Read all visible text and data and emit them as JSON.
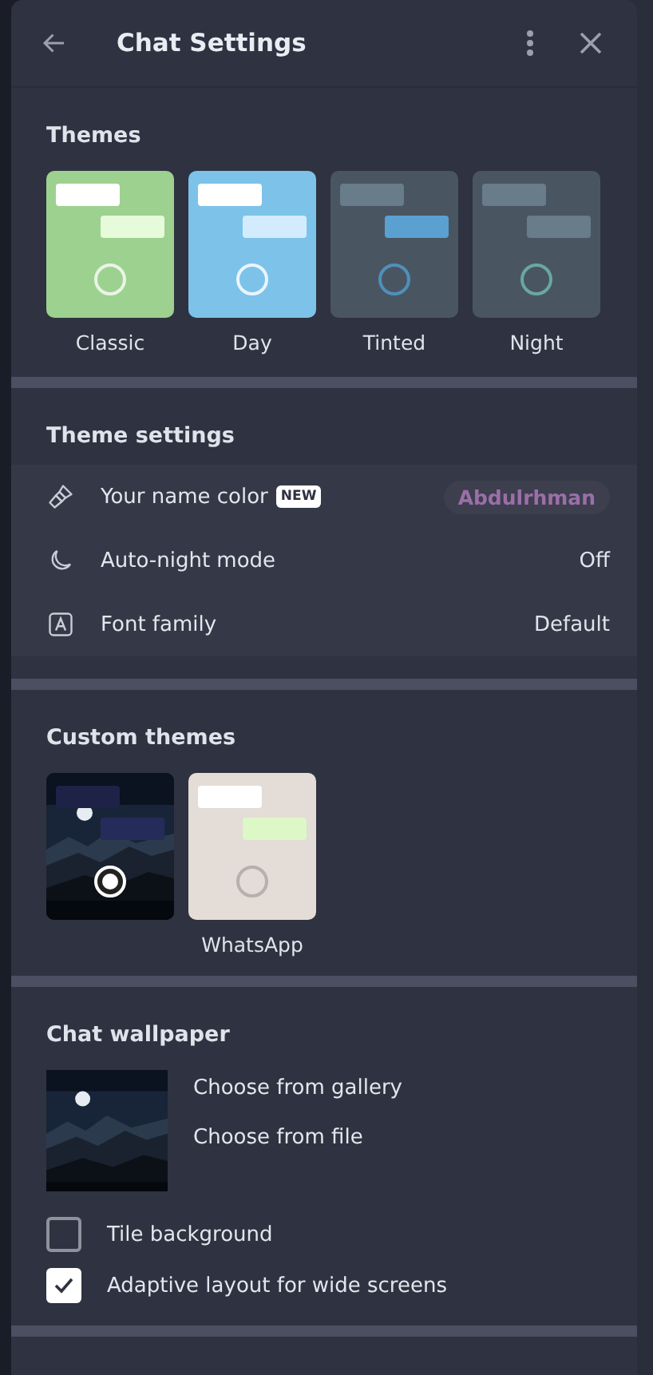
{
  "header": {
    "title": "Chat Settings"
  },
  "themes": {
    "heading": "Themes",
    "items": [
      {
        "kind": "classic",
        "label": "Classic",
        "selected": false
      },
      {
        "kind": "day",
        "label": "Day",
        "selected": false
      },
      {
        "kind": "tinted",
        "label": "Tinted",
        "selected": false
      },
      {
        "kind": "night",
        "label": "Night",
        "selected": false
      }
    ]
  },
  "theme_settings": {
    "heading": "Theme settings",
    "rows": [
      {
        "kind": "brush",
        "label": "Your name color",
        "badge": "NEW",
        "value": "Abdulrhman"
      },
      {
        "kind": "moon",
        "label": "Auto-night mode",
        "value": "Off"
      },
      {
        "kind": "font",
        "label": "Font family",
        "value": "Default"
      }
    ]
  },
  "custom_themes": {
    "heading": "Custom themes",
    "items": [
      {
        "kind": "picture",
        "selected": true
      },
      {
        "kind": "whatsapp",
        "label": "WhatsApp",
        "selected": false
      }
    ]
  },
  "chat_wallpaper": {
    "heading": "Chat wallpaper",
    "links": [
      "Choose from gallery",
      "Choose from file"
    ],
    "options": [
      {
        "label": "Tile background",
        "checked": false
      },
      {
        "label": "Adaptive layout for wide screens",
        "checked": true
      }
    ]
  }
}
